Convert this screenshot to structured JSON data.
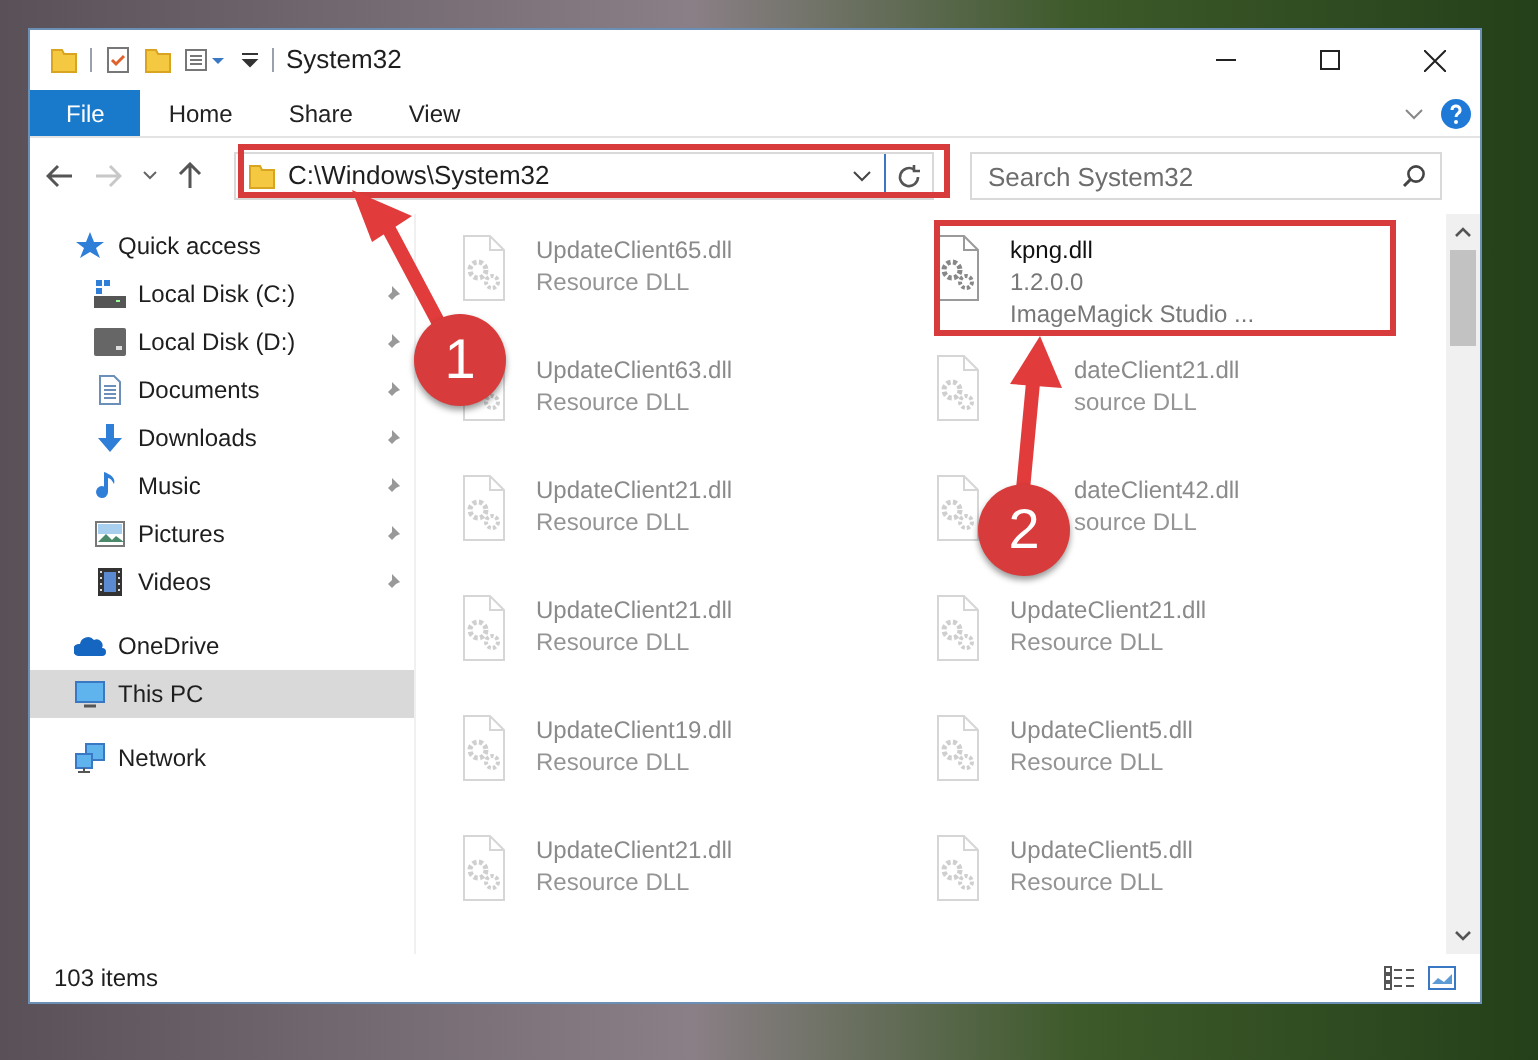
{
  "window": {
    "title": "System32"
  },
  "ribbon_tabs": [
    {
      "label": "File",
      "selected": true
    },
    {
      "label": "Home",
      "selected": false
    },
    {
      "label": "Share",
      "selected": false
    },
    {
      "label": "View",
      "selected": false
    }
  ],
  "address_bar": {
    "value": "C:\\Windows\\System32"
  },
  "search": {
    "placeholder": "Search System32"
  },
  "sidebar": {
    "items": [
      {
        "label": "Quick access",
        "selected": false,
        "children": [
          {
            "label": "Local Disk (C:)",
            "pinned": true,
            "selected": false
          },
          {
            "label": "Local Disk (D:)",
            "pinned": true,
            "selected": false
          },
          {
            "label": "Documents",
            "pinned": true,
            "selected": false
          },
          {
            "label": "Downloads",
            "pinned": true,
            "selected": false
          },
          {
            "label": "Music",
            "pinned": true,
            "selected": false
          },
          {
            "label": "Pictures",
            "pinned": true,
            "selected": false
          },
          {
            "label": "Videos",
            "pinned": true,
            "selected": false
          }
        ]
      },
      {
        "label": "OneDrive",
        "selected": false
      },
      {
        "label": "This PC",
        "selected": true
      },
      {
        "label": "Network",
        "selected": false
      }
    ]
  },
  "files": [
    {
      "kind": "blurred",
      "lines": [
        "UpdateClient65.dll",
        "Resource DLL"
      ]
    },
    {
      "kind": "highlighted",
      "lines": [
        "kpng.dll",
        "1.2.0.0",
        "ImageMagick Studio ..."
      ]
    },
    {
      "kind": "blurred",
      "lines": [
        "UpdateClient63.dll",
        "Resource DLL"
      ]
    },
    {
      "kind": "partly_covered",
      "lines": [
        "dateClient21.dll",
        "source DLL"
      ]
    },
    {
      "kind": "blurred",
      "lines": [
        "UpdateClient21.dll",
        "Resource DLL"
      ]
    },
    {
      "kind": "partly_covered",
      "lines": [
        "dateClient42.dll",
        "source DLL"
      ]
    },
    {
      "kind": "blurred",
      "lines": [
        "UpdateClient21.dll",
        "Resource DLL"
      ]
    },
    {
      "kind": "blurred",
      "lines": [
        "UpdateClient21.dll",
        "Resource DLL"
      ]
    },
    {
      "kind": "blurred",
      "lines": [
        "UpdateClient19.dll",
        "Resource DLL"
      ]
    },
    {
      "kind": "blurred",
      "lines": [
        "UpdateClient5.dll",
        "Resource DLL"
      ]
    },
    {
      "kind": "blurred",
      "lines": [
        "UpdateClient21.dll",
        "Resource DLL"
      ]
    },
    {
      "kind": "blurred",
      "lines": [
        "UpdateClient5.dll",
        "Resource DLL"
      ]
    }
  ],
  "status_bar": {
    "text": "103 items"
  },
  "callouts": [
    {
      "label": "1"
    },
    {
      "label": "2"
    }
  ]
}
